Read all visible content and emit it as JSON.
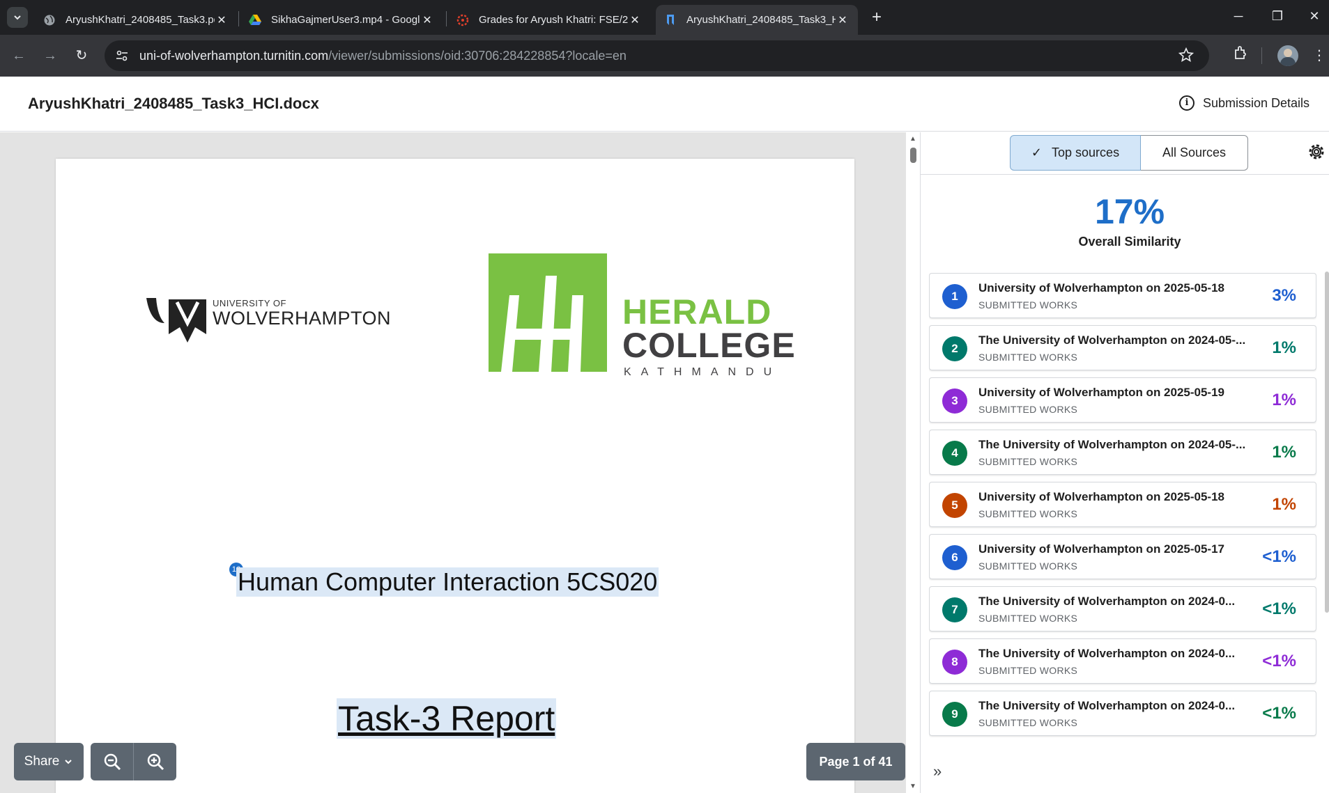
{
  "browser": {
    "tabs": [
      {
        "title": "AryushKhatri_2408485_Task3.pd",
        "icon": "globe-icon"
      },
      {
        "title": "SikhaGajmerUser3.mp4 - Googl",
        "icon": "google-drive-icon"
      },
      {
        "title": "Grades for Aryush Khatri: FSE/2",
        "icon": "canvas-icon"
      },
      {
        "title": "AryushKhatri_2408485_Task3_H",
        "icon": "turnitin-icon"
      }
    ],
    "url_host": "uni-of-wolverhampton.turnitin.com",
    "url_path": "/viewer/submissions/oid:30706:284228854?locale=en"
  },
  "header": {
    "document_title": "AryushKhatri_2408485_Task3_HCI.docx",
    "submission_details_label": "Submission Details"
  },
  "document": {
    "uow_small": "UNIVERSITY OF",
    "uow_big": "WOLVERHAMPTON",
    "herald_line1": "HERALD",
    "herald_line2": "COLLEGE",
    "herald_city": "KATHMANDU",
    "match_badge": "16",
    "heading": "Human Computer Interaction 5CS020",
    "report_title": "Task-3 Report"
  },
  "controls": {
    "share_label": "Share",
    "page_indicator": "Page 1 of 41"
  },
  "panel": {
    "tab_top": "Top sources",
    "tab_all": "All Sources",
    "similarity_score": "17%",
    "similarity_label": "Overall Similarity",
    "sources": [
      {
        "num": "1",
        "name": "University of Wolverhampton on 2025-05-18",
        "type": "SUBMITTED WORKS",
        "pct": "3%",
        "color": "#1e5fd0"
      },
      {
        "num": "2",
        "name": "The University of Wolverhampton on 2024-05-...",
        "type": "SUBMITTED WORKS",
        "pct": "1%",
        "color": "#00796b"
      },
      {
        "num": "3",
        "name": "University of Wolverhampton on 2025-05-19",
        "type": "SUBMITTED WORKS",
        "pct": "1%",
        "color": "#8e2bd6"
      },
      {
        "num": "4",
        "name": "The University of Wolverhampton on 2024-05-...",
        "type": "SUBMITTED WORKS",
        "pct": "1%",
        "color": "#087a4a"
      },
      {
        "num": "5",
        "name": "University of Wolverhampton on 2025-05-18",
        "type": "SUBMITTED WORKS",
        "pct": "1%",
        "color": "#c24400"
      },
      {
        "num": "6",
        "name": "University of Wolverhampton on 2025-05-17",
        "type": "SUBMITTED WORKS",
        "pct": "<1%",
        "color": "#1e5fd0"
      },
      {
        "num": "7",
        "name": "The University of Wolverhampton on 2024-0...",
        "type": "SUBMITTED WORKS",
        "pct": "<1%",
        "color": "#00796b"
      },
      {
        "num": "8",
        "name": "The University of Wolverhampton on 2024-0...",
        "type": "SUBMITTED WORKS",
        "pct": "<1%",
        "color": "#8e2bd6"
      },
      {
        "num": "9",
        "name": "The University of Wolverhampton on 2024-0...",
        "type": "SUBMITTED WORKS",
        "pct": "<1%",
        "color": "#087a4a"
      }
    ]
  }
}
